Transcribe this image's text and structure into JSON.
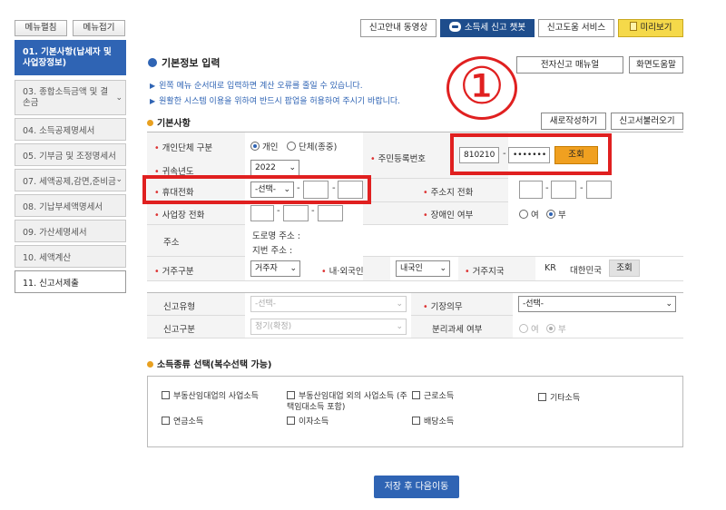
{
  "sidebar": {
    "expand_label": "메뉴펼침",
    "collapse_label": "메뉴접기",
    "items": [
      {
        "label": "01. 기본사항(납세자 및 사업장정보)"
      },
      {
        "label": "03. 종합소득금액 및 결손금"
      },
      {
        "label": "04. 소득공제명세서"
      },
      {
        "label": "05. 기부금 및 조정명세서"
      },
      {
        "label": "07. 세액공제,감면,준비금"
      },
      {
        "label": "08. 기납부세액명세서"
      },
      {
        "label": "09. 가산세명세서"
      },
      {
        "label": "10. 세액계산"
      },
      {
        "label": "11. 신고서제출"
      }
    ]
  },
  "topbar": {
    "video_guide": "신고안내 동영상",
    "chatbot": "소득세 신고 챗봇",
    "help_service": "신고도움 서비스",
    "preview": "미리보기"
  },
  "header": {
    "title": "기본정보 입력",
    "note1": "왼쪽 메뉴 순서대로 입력하면 계산 오류를 줄일 수 있습니다.",
    "note2": "원활한 시스템 이용을 위하여 반드시 팝업을 허용하여 주시기 바랍니다.",
    "manual_button": "전자신고 매뉴얼",
    "screen_help_button": "화면도움말",
    "annotation": "①"
  },
  "basic": {
    "section_title": "기본사항",
    "new_button": "새로작성하기",
    "load_button": "신고서불러오기",
    "type_label": "개인단체 구분",
    "type_options": [
      "개인",
      "단체(종중)"
    ],
    "year_label": "귀속년도",
    "year_value": "2022",
    "rrn_label": "주민등록번호",
    "rrn_front": "810210",
    "rrn_back": "•••••••",
    "lookup_button": "조회",
    "mobile_label": "휴대전화",
    "mobile_select": "-선택-",
    "home_phone_label": "주소지 전화",
    "biz_phone_label": "사업장 전화",
    "disabled_label": "장애인 여부",
    "disabled_yes": "여",
    "disabled_no": "부",
    "address_label": "주소",
    "road_address": "도로명 주소 :",
    "lot_address": "지번 주소 :",
    "residence_label": "거주구분",
    "residence_value": "거주자",
    "nationality_label": "내·외국인",
    "nationality_value": "내국인",
    "country_label": "거주지국",
    "country_code": "KR",
    "country_name": "대한민국",
    "country_lookup": "조회"
  },
  "filing": {
    "type_label": "신고유형",
    "type_value": "-선택-",
    "bookkeeping_label": "기장의무",
    "bookkeeping_value": "-선택-",
    "category_label": "신고구분",
    "category_value": "정기(확정)",
    "separate_tax_label": "분리과세 여부",
    "separate_yes": "여",
    "separate_no": "부"
  },
  "income": {
    "section_title": "소득종류 선택(복수선택 가능)",
    "items": [
      "부동산임대업의 사업소득",
      "부동산임대업 외의 사업소득 (주택임대소득 포함)",
      "근로소득",
      "기타소득",
      "연금소득",
      "이자소득",
      "배당소득"
    ]
  },
  "footer": {
    "save_next": "저장 후 다음이동"
  }
}
